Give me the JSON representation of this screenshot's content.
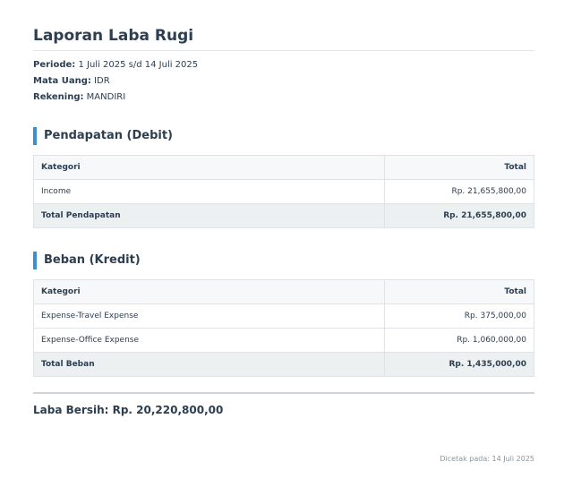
{
  "report": {
    "title": "Laporan Laba Rugi",
    "meta": {
      "periode_label": "Periode:",
      "periode_value": " 1 Juli 2025 s/d 14 Juli 2025",
      "mata_uang_label": "Mata Uang:",
      "mata_uang_value": " IDR",
      "rekening_label": "Rekening:",
      "rekening_value": " MANDIRI"
    },
    "income_section": {
      "heading": "Pendapatan (Debit)",
      "col_category": "Kategori",
      "col_total": "Total",
      "rows": [
        {
          "category": "Income",
          "total": "Rp. 21,655,800,00"
        }
      ],
      "total_label": "Total Pendapatan",
      "total_value": "Rp. 21,655,800,00"
    },
    "expense_section": {
      "heading": "Beban (Kredit)",
      "col_category": "Kategori",
      "col_total": "Total",
      "rows": [
        {
          "category": "Expense-Travel Expense",
          "total": "Rp. 375,000,00"
        },
        {
          "category": "Expense-Office Expense",
          "total": "Rp. 1,060,000,00"
        }
      ],
      "total_label": "Total Beban",
      "total_value": "Rp. 1,435,000,00"
    },
    "net_profit": "Laba Bersih: Rp. 20,220,800,00",
    "footer": "Dicetak pada: 14 Juli 2025"
  },
  "colors": {
    "text": "#2c3e50",
    "accent": "#3a8fd0",
    "header_bg": "#f7f8fa",
    "total_bg": "#ecf0f1",
    "muted": "#8a949c"
  }
}
